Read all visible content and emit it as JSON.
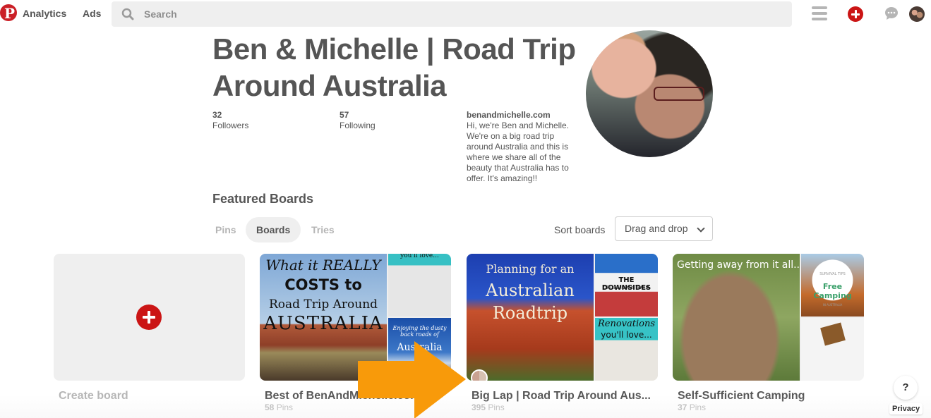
{
  "nav": {
    "logo": "P",
    "analytics": "Analytics",
    "ads": "Ads",
    "search_placeholder": "Search",
    "icons": [
      "menu-icon",
      "add-icon",
      "messages-icon",
      "user-avatar"
    ]
  },
  "profile": {
    "title": "Ben & Michelle | Road Trip Around Australia",
    "followers_count": "32",
    "followers_label": "Followers",
    "following_count": "57",
    "following_label": "Following",
    "website": "benandmichelle.com",
    "bio": "Hi, we're Ben and Michelle. We're on a big road trip around Australia and this is where we share all of the beauty that Australia has to offer. It's amazing!!"
  },
  "featured_heading": "Featured Boards",
  "tabs": [
    {
      "label": "Pins",
      "active": false
    },
    {
      "label": "Boards",
      "active": true
    },
    {
      "label": "Tries",
      "active": false
    }
  ],
  "sort": {
    "label": "Sort boards",
    "selected": "Drag and drop"
  },
  "boards": [
    {
      "name": "Create board",
      "type": "create"
    },
    {
      "name": "Best of BenAndMichelle.com",
      "pin_count": "58",
      "pins_label": "Pins",
      "cover_text": [
        "What it REALLY",
        "COSTS to",
        "Road Trip Around",
        "AUSTRALIA"
      ],
      "thumb_text": [
        "you'll love...",
        "Enjoying the dusty back roads of",
        "Australia"
      ]
    },
    {
      "name": "Big Lap | Road Trip Around Aus...",
      "pin_count": "395",
      "pins_label": "Pins",
      "cover_text": [
        "Planning for an",
        "Australian",
        "Roadtrip"
      ],
      "thumb_text": [
        "THE DOWNSIDES",
        "OF LIFE IN AUSTRALIA",
        "Renovations",
        "you'll love..."
      ]
    },
    {
      "name": "Self-Sufficient Camping",
      "pin_count": "37",
      "pins_label": "Pins",
      "cover_text": [
        "Getting away from it all..."
      ],
      "thumb_text": [
        "SURVIVAL TIPS",
        "Free",
        "Camping",
        "IN AUSTRALIA"
      ]
    }
  ],
  "help": {
    "question": "?",
    "privacy": "Privacy"
  },
  "colors": {
    "brand_red": "#cb2027",
    "annotation_arrow": "#f89a0a",
    "text": "#555555",
    "muted": "#b5b5b5"
  }
}
